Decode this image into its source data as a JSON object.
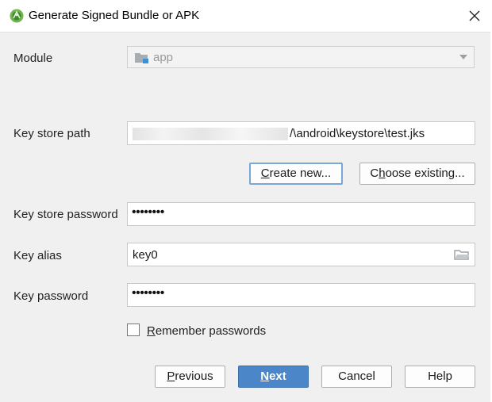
{
  "window": {
    "title": "Generate Signed Bundle or APK",
    "icon": "android-studio-icon"
  },
  "form": {
    "module_label": "Module",
    "module_value": "app",
    "key_store_path_label": "Key store path",
    "key_store_path_visible": "/\\android\\keystore\\test.jks",
    "create_new_label": "Create new...",
    "choose_existing_label": "Choose existing...",
    "key_store_password_label": "Key store password",
    "key_store_password_value": "••••••••",
    "key_alias_label": "Key alias",
    "key_alias_value": "key0",
    "key_password_label": "Key password",
    "key_password_value": "••••••••",
    "remember_label": "Remember passwords",
    "remember_checked": false
  },
  "footer": {
    "previous_label": "Previous",
    "next_label": "Next",
    "cancel_label": "Cancel",
    "help_label": "Help"
  },
  "colors": {
    "primary_button": "#4a86c8",
    "default_focus_border": "#7aa7d6",
    "dialog_bg": "#f0f0f0"
  }
}
